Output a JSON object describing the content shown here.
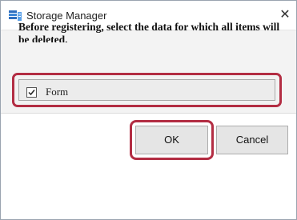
{
  "window": {
    "title": "Storage Manager",
    "app_icon": "storage-manager-app-icon",
    "close_icon": "close-icon",
    "close_glyph": "✕"
  },
  "dialog": {
    "message": "Before registering, select the data for which all items will be deleted.",
    "items": [
      {
        "label": "Form",
        "checked": true
      }
    ]
  },
  "buttons": {
    "ok_label": "OK",
    "cancel_label": "Cancel"
  },
  "colors": {
    "highlight": "#b32d43",
    "button_face": "#e5e5e5",
    "content_bg": "#f3f3f3"
  }
}
